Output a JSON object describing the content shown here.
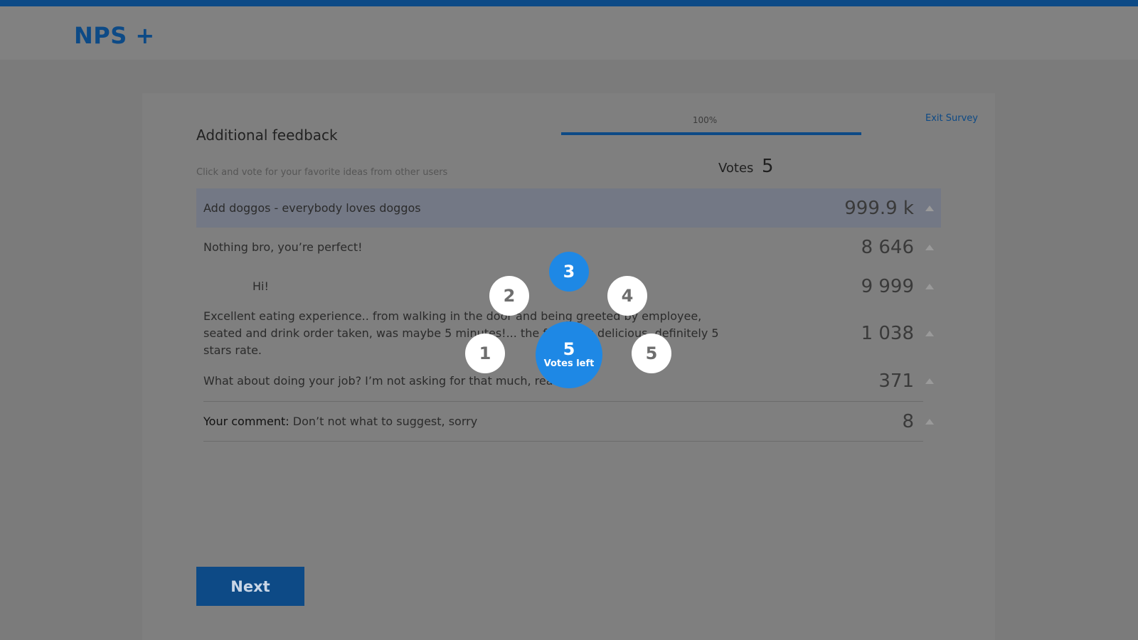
{
  "app": {
    "logo": "NPS +",
    "brand_color": "#0d4a86",
    "accent_color": "#1e88e5"
  },
  "progress": {
    "label": "100%",
    "value": 100
  },
  "exit_link": "Exit Survey",
  "section": {
    "title": "Additional feedback",
    "instructions": "Click and vote for your favorite ideas from other users",
    "votes_label": "Votes",
    "votes_count": "5"
  },
  "rows": [
    {
      "text": "Add doggos - everybody loves doggos",
      "count": "999.9 k",
      "highlighted": true
    },
    {
      "text": "Nothing bro, you’re perfect!",
      "count": "8 646"
    },
    {
      "text": "Hi!",
      "count": "9 999",
      "indented": true
    },
    {
      "text": "Excellent eating experience.. from walking in the door and being greeted by employee, seated and drink order taken, was maybe 5 minutes!... the food was delicious, definitely 5 stars rate.",
      "count": "1 038"
    },
    {
      "text": "What about doing your job? I’m not asking for that much, really?",
      "count": "371"
    },
    {
      "prefix": "Your comment:",
      "text": "Don’t not what to suggest, sorry",
      "count": "8"
    }
  ],
  "vote_picker": {
    "options": [
      "1",
      "2",
      "3",
      "4",
      "5"
    ],
    "selected": "3",
    "votes_left_count": "5",
    "votes_left_label": "Votes left"
  },
  "next_button": "Next",
  "icons": {
    "row_upvote": "triangle-up-icon"
  }
}
